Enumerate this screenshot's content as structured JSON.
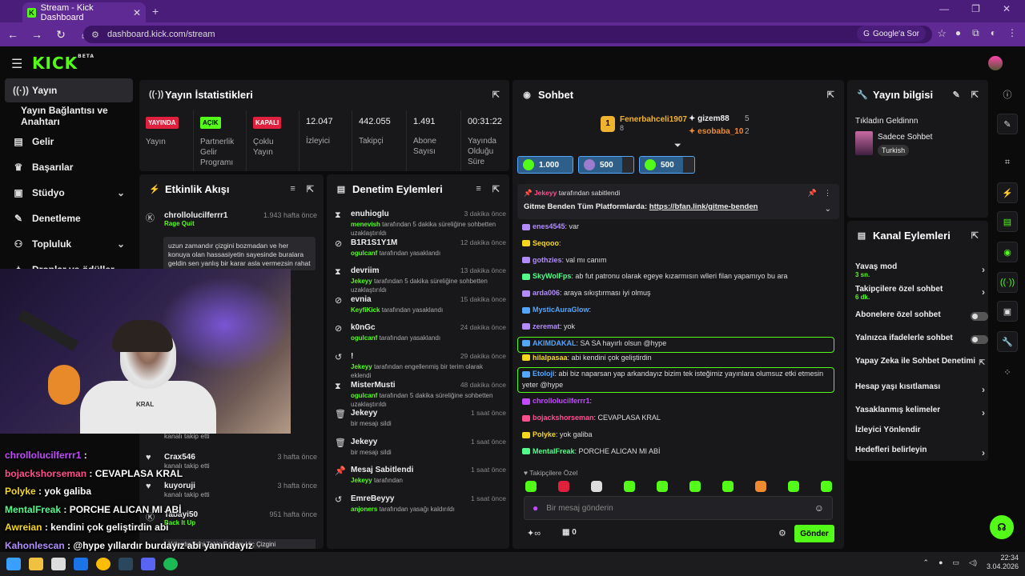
{
  "browser": {
    "tab_title": "Stream - Kick Dashboard",
    "url": "dashboard.kick.com/stream",
    "google_button": "Google'a Sor"
  },
  "app": {
    "logo": "KICK",
    "logo_sup": "BETA"
  },
  "sidebar": {
    "items": [
      {
        "label": "Yayın",
        "icon": "broadcast-icon"
      },
      {
        "label": "Yayın Bağlantısı ve Anahtarı",
        "icon": ""
      },
      {
        "label": "Gelir",
        "icon": "wallet-icon"
      },
      {
        "label": "Başarılar",
        "icon": "trophy-icon"
      },
      {
        "label": "Stüdyo",
        "icon": "studio-icon"
      },
      {
        "label": "Denetleme",
        "icon": "wrench-icon"
      },
      {
        "label": "Topluluk",
        "icon": "people-icon"
      },
      {
        "label": "Droplar ve ödüller",
        "icon": "gift-icon"
      }
    ]
  },
  "webcam": {
    "shirt_brand": "KRAL"
  },
  "overlay_chat": [
    {
      "user": "chrollolucilferrr1",
      "text": ":",
      "color": "#c34bff"
    },
    {
      "user": "bojackshorseman",
      "text": ": CEVAPLASA KRAL",
      "color": "#ff4f8e"
    },
    {
      "user": "Polyke",
      "text": ": yok galiba",
      "color": "#f7d71e"
    },
    {
      "user": "MentalFreak",
      "text": ": PORCHE ALICAN MI ABİ",
      "color": "#53fc8a"
    },
    {
      "user": "Awreian",
      "text": ": kendini çok geliştirdin abi",
      "color": "#f7d71e"
    },
    {
      "user": "Kahonlescan",
      "text": ": @hype yıllardır burdayız abi yanındayız",
      "color": "#b28cff"
    }
  ],
  "stats": {
    "title": "Yayın İstatistikleri",
    "items": [
      {
        "badge": "YAYINDA",
        "label": "Yayın"
      },
      {
        "badge": "AÇIK",
        "label": "Partnerlik Gelir Programı"
      },
      {
        "badge": "KAPALI",
        "label": "Çoklu Yayın"
      },
      {
        "value": "12.047",
        "label": "İzleyici"
      },
      {
        "value": "442.055",
        "label": "Takipçi"
      },
      {
        "value": "1.491",
        "label": "Abone Sayısı"
      },
      {
        "value": "00:31:22",
        "label": "Yayında Olduğu Süre"
      }
    ],
    "colors": {
      "live": "#e0213d",
      "on": "#53fc18",
      "off": "#e0213d"
    }
  },
  "events": {
    "title": "Etkinlik Akışı",
    "items": [
      {
        "name": "chrollolucilferrr1",
        "time": "1.943 hafta önce",
        "sub": "Rage Quit",
        "msg": "uzun zamandır çizgini bozmadan ve her konuya olan hassasiyetin sayesinde buralara geldin sen yanlış bir karar asla vermezsin rahat ver mi",
        "icon": "kick-coin-icon"
      },
      {
        "name": "Crax546",
        "time": "3 hafta önce",
        "sub": "kanalı takip etti",
        "icon": "heart-icon"
      },
      {
        "name": "kuyoruji",
        "time": "3 hafta önce",
        "sub": "kanalı takip etti",
        "icon": "heart-icon"
      },
      {
        "name": "Tabayi50",
        "time": "951 hafta önce",
        "sub": "Back It Up",
        "icon": "kick-coin-icon"
      },
      {
        "name": "Yıllardır Seni Takip Ederim Hiç Çizgini",
        "time": "",
        "sub": "",
        "icon": ""
      }
    ],
    "partial_follow": "kanalı takip etti"
  },
  "moderation": {
    "title": "Denetim Eylemleri",
    "items": [
      {
        "name": "enuhioglu",
        "time": "3 dakika önce",
        "mod": "menevish",
        "desc": "tarafından 5 dakika süreliğine sohbetten uzaklaştırıldı",
        "icon": "hourglass-icon"
      },
      {
        "name": "B1R1S1Y1M",
        "time": "12 dakika önce",
        "mod": "ogulcanf",
        "desc": "tarafından yasaklandı",
        "icon": "ban-icon"
      },
      {
        "name": "devriim",
        "time": "13 dakika önce",
        "mod": "Jekeyy",
        "desc": "tarafından 5 dakika süreliğine sohbetten uzaklaştırıldı",
        "icon": "hourglass-icon"
      },
      {
        "name": "evnia",
        "time": "15 dakika önce",
        "mod": "KeyfiKick",
        "desc": "tarafından yasaklandı",
        "icon": "ban-icon"
      },
      {
        "name": "k0nGc",
        "time": "24 dakika önce",
        "mod": "ogulcanf",
        "desc": "tarafından yasaklandı",
        "icon": "ban-icon"
      },
      {
        "name": "!",
        "time": "29 dakika önce",
        "mod": "Jekeyy",
        "desc": "tarafından engellenmiş bir terim olarak eklendi",
        "icon": "undo-icon"
      },
      {
        "name": "MisterMusti",
        "time": "48 dakika önce",
        "mod": "ogulcanf",
        "desc": "tarafından 5 dakika süreliğine sohbetten uzaklaştırıldı",
        "icon": "hourglass-icon"
      },
      {
        "name": "Jekeyy",
        "time": "1 saat önce",
        "mod": "",
        "desc": "bir mesajı sildi",
        "icon": "trash-icon"
      },
      {
        "name": "Jekeyy",
        "time": "1 saat önce",
        "mod": "",
        "desc": "bir mesajı sildi",
        "icon": "trash-icon"
      },
      {
        "name": "Mesaj Sabitlendi",
        "time": "1 saat önce",
        "mod": "Jekeyy",
        "desc": "tarafından",
        "icon": "pin-icon"
      },
      {
        "name": "EmreBeyyy",
        "time": "1 saat önce",
        "mod": "anjoners",
        "desc": "tarafından yasağı kaldırıldı",
        "icon": "undo-icon"
      }
    ]
  },
  "chat": {
    "title": "Sohbet",
    "top_gifters": [
      {
        "rank": "1",
        "name": "Fenerbahceli1907",
        "count": "8"
      },
      {
        "name": "gizem88",
        "count": "5"
      },
      {
        "name": "esobaba_10",
        "count": "2"
      }
    ],
    "chips": [
      "1.000",
      "500",
      "500"
    ],
    "pinned": {
      "by": "Jekeyy",
      "by_suffix": "tarafından sabitlendi",
      "text": "Gitme Benden Tüm Platformlarda:",
      "link": "https://bfan.link/gitme-benden"
    },
    "messages": [
      {
        "user": "enes4545",
        "text": ": var",
        "color": "#b28cff"
      },
      {
        "user": "Seqooo",
        "text": ":",
        "color": "#f7d71e"
      },
      {
        "user": "gothzies",
        "text": ": val mı canım",
        "color": "#b28cff"
      },
      {
        "user": "SkyWolFps",
        "text": ": ab fut patronu olarak egeye kızarmısın wlleri filan yapamıyo bu ara",
        "color": "#53fc8a"
      },
      {
        "user": "arda006",
        "text": ": araya sıkıştırması iyi olmuş",
        "color": "#b28cff"
      },
      {
        "user": "MysticAuraGlow",
        "text": ":",
        "color": "#53a6fc"
      },
      {
        "user": "zeremat",
        "text": ": yok",
        "color": "#b28cff"
      },
      {
        "user": "AKIMDAKAL",
        "text": ": SA SA hayırlı olsun @hype",
        "color": "#53a6fc"
      },
      {
        "user": "hilalpasaa",
        "text": ": abi kendini çok geliştirdin",
        "color": "#f7d71e"
      },
      {
        "user": "Etoloji",
        "text": ": abi biz naparsan yap arkandayız bizim tek isteğimiz yayınlara olumsuz etki etmesin",
        "text2": "yeter @hype",
        "color": "#53a6fc"
      },
      {
        "user": "chrollolucilferrr1",
        "text": ":",
        "color": "#c34bff"
      },
      {
        "user": "bojackshorseman",
        "text": ": CEVAPLASA KRAL",
        "color": "#ff4f8e"
      },
      {
        "user": "Polyke",
        "text": ": yok galiba",
        "color": "#f7d71e"
      },
      {
        "user": "MentalFreak",
        "text": ": PORCHE ALICAN MI ABİ",
        "color": "#53fc8a"
      }
    ],
    "followers_only": "Takipçilere Özel",
    "input_placeholder": "Bir mesaj gönderin",
    "gift_count": "0",
    "send_label": "Gönder"
  },
  "stream_info": {
    "title": "Yayın bilgisi",
    "stream_title": "Tıkladın Geldinnn",
    "category": "Sadece Sohbet",
    "language": "Turkish"
  },
  "channel_actions": {
    "title": "Kanal Eylemleri",
    "items": [
      {
        "label": "Yavaş mod",
        "sub": "3 sn.",
        "control": "arrow"
      },
      {
        "label": "Takipçilere özel sohbet",
        "sub": "6 dk.",
        "control": "arrow"
      },
      {
        "label": "Abonelere özel sohbet",
        "sub": "",
        "control": "toggle"
      },
      {
        "label": "Yalnızca ifadelerle sohbet",
        "sub": "",
        "control": "toggle"
      },
      {
        "label": "Yapay Zeka ile Sohbet Denetimi",
        "sub": "",
        "control": "external"
      },
      {
        "label": "Hesap yaşı kısıtlaması",
        "sub": "",
        "control": "arrow"
      },
      {
        "label": "Yasaklanmış kelimeler",
        "sub": "",
        "control": "arrow"
      },
      {
        "label": "İzleyici Yönlendir",
        "sub": "",
        "control": "none"
      },
      {
        "label": "Hedefleri belirleyin",
        "sub": "",
        "control": "arrow"
      }
    ]
  },
  "taskbar": {
    "time": "22:34",
    "date": "3.04.2026"
  }
}
